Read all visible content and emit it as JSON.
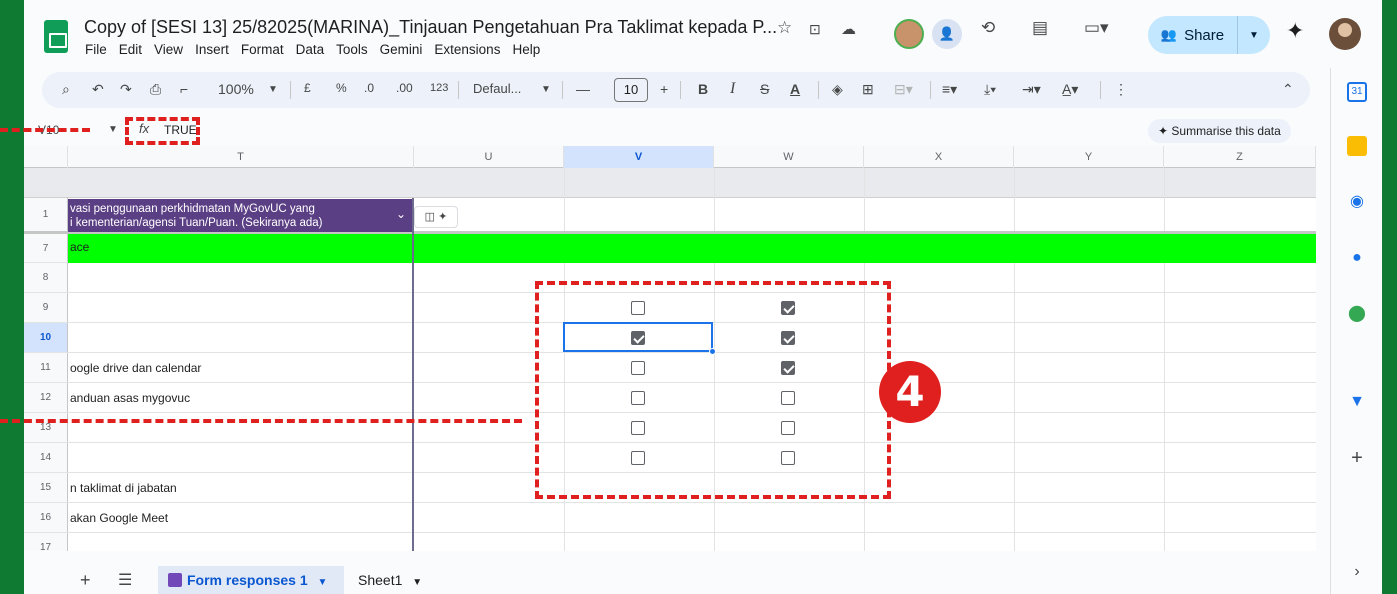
{
  "doc": {
    "title": "Copy of [SESI 13] 25/82025(MARINA)_Tinjauan Pengetahuan Pra Taklimat kepada P...",
    "menu": [
      "File",
      "Edit",
      "View",
      "Insert",
      "Format",
      "Data",
      "Tools",
      "Gemini",
      "Extensions",
      "Help"
    ]
  },
  "header_icons": [
    "star-icon",
    "move-folder-icon",
    "cloud-status-icon",
    "history-icon",
    "comment-icon",
    "meet-icon",
    "gemini-icon"
  ],
  "share": {
    "label": "Share"
  },
  "toolbar": {
    "zoom": "100%",
    "currency": "£",
    "percent": "%",
    "decrease_decimal": ".0",
    "increase_decimal": ".00",
    "number_format": "123",
    "font": "Defaul...",
    "font_size": "10",
    "bold": "B",
    "italic": "I",
    "strike": "S",
    "text_color": "A"
  },
  "formula_bar": {
    "name_box": "V10",
    "fx": "fx",
    "value": "TRUE",
    "summarise": "Summarise this data"
  },
  "columns": [
    "T",
    "U",
    "V",
    "W",
    "X",
    "Y",
    "Z"
  ],
  "selected_column": "V",
  "frozen_header": {
    "row": "1",
    "text_line1": "vasi penggunaan perkhidmatan MyGovUC yang",
    "text_line2": "i kementerian/agensi Tuan/Puan. (Sekiranya ada)"
  },
  "rows": [
    {
      "num": "7",
      "text": "ace",
      "highlight": "#00ff00"
    },
    {
      "num": "8",
      "text": ""
    },
    {
      "num": "9",
      "text": "",
      "v": false,
      "w": true
    },
    {
      "num": "10",
      "text": "",
      "v": true,
      "w": true,
      "selected": true
    },
    {
      "num": "11",
      "text": "oogle drive dan calendar",
      "v": false,
      "w": true
    },
    {
      "num": "12",
      "text": "anduan asas mygovuc",
      "v": false,
      "w": false
    },
    {
      "num": "13",
      "text": "",
      "v": false,
      "w": false
    },
    {
      "num": "14",
      "text": "",
      "v": false,
      "w": false
    },
    {
      "num": "15",
      "text": "n taklimat di jabatan"
    },
    {
      "num": "16",
      "text": "akan Google Meet"
    },
    {
      "num": "17",
      "text": ""
    }
  ],
  "sheets": [
    {
      "label": "Form responses 1",
      "active": true
    },
    {
      "label": "Sheet1",
      "active": false
    }
  ],
  "annotation": {
    "step": "4",
    "color": "#e0201f"
  },
  "colors": {
    "accent": "#0b57d0",
    "header_purple": "#5b3f84",
    "green_row": "#00ff00",
    "outer_bg": "#0f7a32"
  }
}
